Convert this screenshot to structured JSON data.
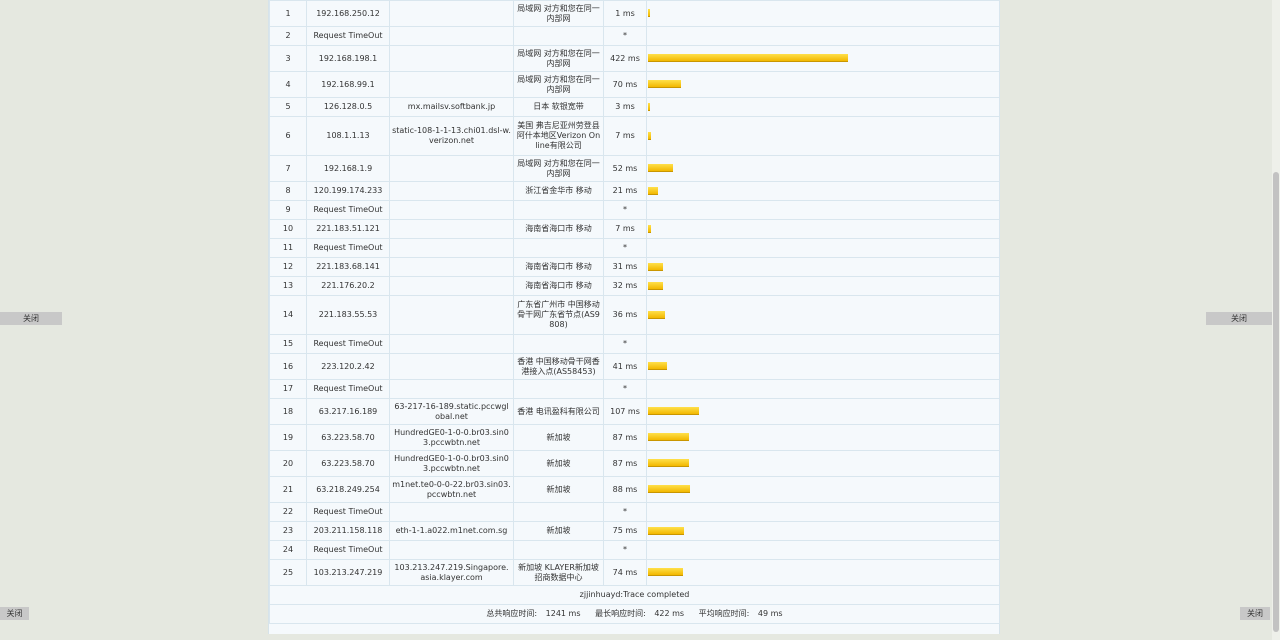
{
  "side_buttons": {
    "close_label": "关闭"
  },
  "rows": [
    {
      "hop": "1",
      "ip": "192.168.250.12",
      "host": "",
      "loc": "局域网 对方和您在同一内部网",
      "time": "1 ms",
      "ms": 1
    },
    {
      "hop": "2",
      "ip": "Request TimeOut",
      "host": "",
      "loc": "",
      "time": "*",
      "ms": 0
    },
    {
      "hop": "3",
      "ip": "192.168.198.1",
      "host": "",
      "loc": "局域网 对方和您在同一内部网",
      "time": "422 ms",
      "ms": 422
    },
    {
      "hop": "4",
      "ip": "192.168.99.1",
      "host": "",
      "loc": "局域网 对方和您在同一内部网",
      "time": "70 ms",
      "ms": 70
    },
    {
      "hop": "5",
      "ip": "126.128.0.5",
      "host": "mx.mailsv.softbank.jp",
      "loc": "日本 软银宽带",
      "time": "3 ms",
      "ms": 3
    },
    {
      "hop": "6",
      "ip": "108.1.1.13",
      "host": "static-108-1-1-13.chi01.dsl-w.verizon.net",
      "loc": "美国 弗吉尼亚州劳登县阿什本地区Verizon Online有限公司",
      "time": "7 ms",
      "ms": 7
    },
    {
      "hop": "7",
      "ip": "192.168.1.9",
      "host": "",
      "loc": "局域网 对方和您在同一内部网",
      "time": "52 ms",
      "ms": 52
    },
    {
      "hop": "8",
      "ip": "120.199.174.233",
      "host": "",
      "loc": "浙江省金华市 移动",
      "time": "21 ms",
      "ms": 21
    },
    {
      "hop": "9",
      "ip": "Request TimeOut",
      "host": "",
      "loc": "",
      "time": "*",
      "ms": 0
    },
    {
      "hop": "10",
      "ip": "221.183.51.121",
      "host": "",
      "loc": "海南省海口市 移动",
      "time": "7 ms",
      "ms": 7
    },
    {
      "hop": "11",
      "ip": "Request TimeOut",
      "host": "",
      "loc": "",
      "time": "*",
      "ms": 0
    },
    {
      "hop": "12",
      "ip": "221.183.68.141",
      "host": "",
      "loc": "海南省海口市 移动",
      "time": "31 ms",
      "ms": 31
    },
    {
      "hop": "13",
      "ip": "221.176.20.2",
      "host": "",
      "loc": "海南省海口市 移动",
      "time": "32 ms",
      "ms": 32
    },
    {
      "hop": "14",
      "ip": "221.183.55.53",
      "host": "",
      "loc": "广东省广州市 中国移动骨干网广东省节点(AS9808)",
      "time": "36 ms",
      "ms": 36
    },
    {
      "hop": "15",
      "ip": "Request TimeOut",
      "host": "",
      "loc": "",
      "time": "*",
      "ms": 0
    },
    {
      "hop": "16",
      "ip": "223.120.2.42",
      "host": "",
      "loc": "香港 中国移动骨干网香港接入点(AS58453)",
      "time": "41 ms",
      "ms": 41
    },
    {
      "hop": "17",
      "ip": "Request TimeOut",
      "host": "",
      "loc": "",
      "time": "*",
      "ms": 0
    },
    {
      "hop": "18",
      "ip": "63.217.16.189",
      "host": "63-217-16-189.static.pccwglobal.net",
      "loc": "香港 电讯盈科有限公司",
      "time": "107 ms",
      "ms": 107
    },
    {
      "hop": "19",
      "ip": "63.223.58.70",
      "host": "HundredGE0-1-0-0.br03.sin03.pccwbtn.net",
      "loc": "新加坡",
      "time": "87 ms",
      "ms": 87
    },
    {
      "hop": "20",
      "ip": "63.223.58.70",
      "host": "HundredGE0-1-0-0.br03.sin03.pccwbtn.net",
      "loc": "新加坡",
      "time": "87 ms",
      "ms": 87
    },
    {
      "hop": "21",
      "ip": "63.218.249.254",
      "host": "m1net.te0-0-0-22.br03.sin03.pccwbtn.net",
      "loc": "新加坡",
      "time": "88 ms",
      "ms": 88
    },
    {
      "hop": "22",
      "ip": "Request TimeOut",
      "host": "",
      "loc": "",
      "time": "*",
      "ms": 0
    },
    {
      "hop": "23",
      "ip": "203.211.158.118",
      "host": "eth-1-1.a022.m1net.com.sg",
      "loc": "新加坡",
      "time": "75 ms",
      "ms": 75
    },
    {
      "hop": "24",
      "ip": "Request TimeOut",
      "host": "",
      "loc": "",
      "time": "*",
      "ms": 0
    },
    {
      "hop": "25",
      "ip": "103.213.247.219",
      "host": "103.213.247.219.Singapore.asia.klayer.com",
      "loc": "新加坡 KLAYER新加坡招商数据中心",
      "time": "74 ms",
      "ms": 74
    }
  ],
  "max_ms": 422,
  "footer": {
    "status": "zjjinhuayd:Trace completed",
    "total_label": "总共响应时间:",
    "total_value": "1241 ms",
    "max_label": "最长响应时间:",
    "max_value": "422 ms",
    "avg_label": "平均响应时间:",
    "avg_value": "49 ms"
  },
  "colors": {
    "bar": "#f2c200",
    "panel_bg": "#f5f9fc",
    "page_bg": "#e5e8e0"
  }
}
